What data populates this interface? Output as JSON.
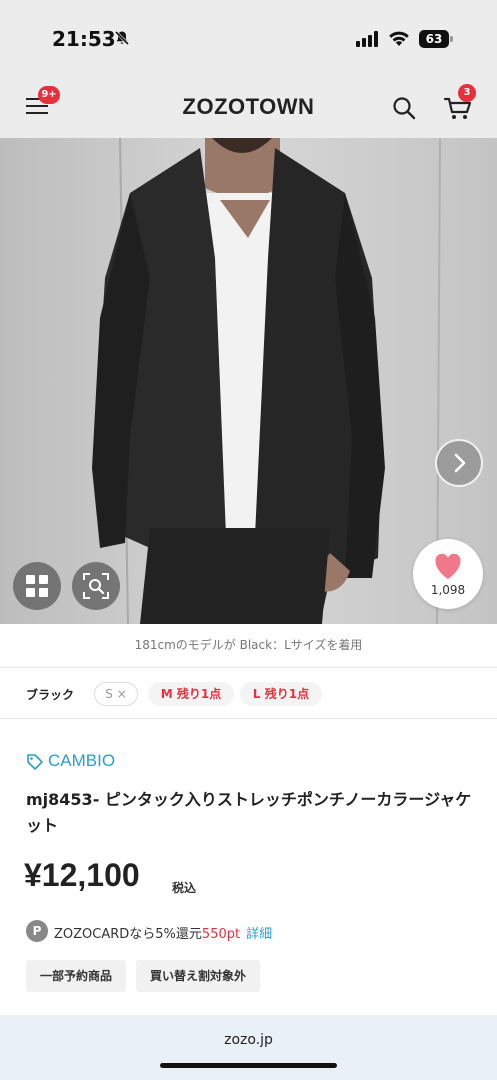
{
  "status_bar": {
    "time": "21:53",
    "battery": "63",
    "icons": [
      "bell-muted-icon",
      "signal-icon",
      "wifi-icon",
      "battery-icon"
    ]
  },
  "header": {
    "logo": "ZOZOTOWN",
    "menu_badge": "9+",
    "cart_badge": "3",
    "icons": [
      "menu-icon",
      "search-icon",
      "cart-icon"
    ],
    "accent_color": "#e8303d"
  },
  "gallery": {
    "favorite_count": "1,098",
    "model_note": "181cmのモデルが Black：Lサイズを着用",
    "icons": [
      "chevron-right-icon",
      "grid-icon",
      "image-search-icon",
      "heart-icon"
    ]
  },
  "variants": {
    "color_label": "ブラック",
    "sizes": [
      {
        "label": "S",
        "status": "×"
      },
      {
        "label": "M",
        "status": "残り1点"
      },
      {
        "label": "L",
        "status": "残り1点"
      }
    ]
  },
  "product": {
    "brand": "CAMBIO",
    "title": "mj8453- ピンタック入りストレッチポンチノーカラージャケット",
    "price": "¥12,100",
    "tax_note": "税込",
    "card_prefix": "ZOZOCARDなら5%還元",
    "card_points": "550pt",
    "card_detail": "詳細",
    "tags": [
      "一部予約商品",
      "買い替え割対象外"
    ],
    "brand_color": "#2a9fd0"
  },
  "browser": {
    "url": "zozo.jp"
  }
}
